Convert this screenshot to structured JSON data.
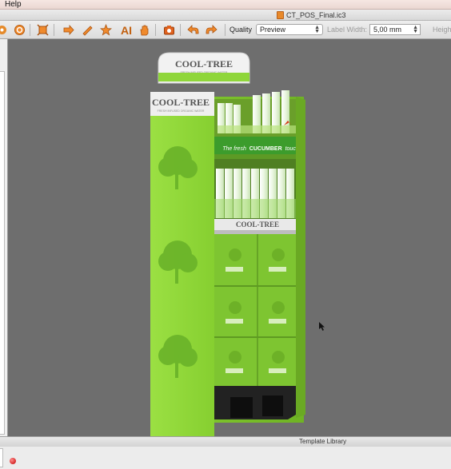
{
  "menubar": {
    "help": "Help"
  },
  "window": {
    "title": "CT_POS_Final.ic3"
  },
  "toolbar": {
    "quality_label": "Quality",
    "quality_value": "Preview",
    "label_width_label": "Label Width:",
    "label_width_value": "5,00 mm",
    "height_label": "Heigh",
    "icons": [
      "settings-icon",
      "circle-icon",
      "fit-icon",
      "arrow-right-icon",
      "edit-icon",
      "star-icon",
      "ai-icon",
      "hand-icon",
      "camera-icon",
      "undo-icon",
      "redo-icon"
    ],
    "ai_text": "AI"
  },
  "display": {
    "brand": "COOL-TREE",
    "tagline": "FRESH INFUSED ORGANIC WATER",
    "banner": "The fresh CUCUMBER touch",
    "banner_italic": "The fresh",
    "banner_bold": "CUCUMBER",
    "banner_tail": "touch"
  },
  "statusbar": {
    "template_library": "Template Library"
  },
  "colors": {
    "viewport_bg": "#6e6e6e",
    "stand_green": "#8fd63a",
    "accent_orange": "#e07a1f"
  }
}
